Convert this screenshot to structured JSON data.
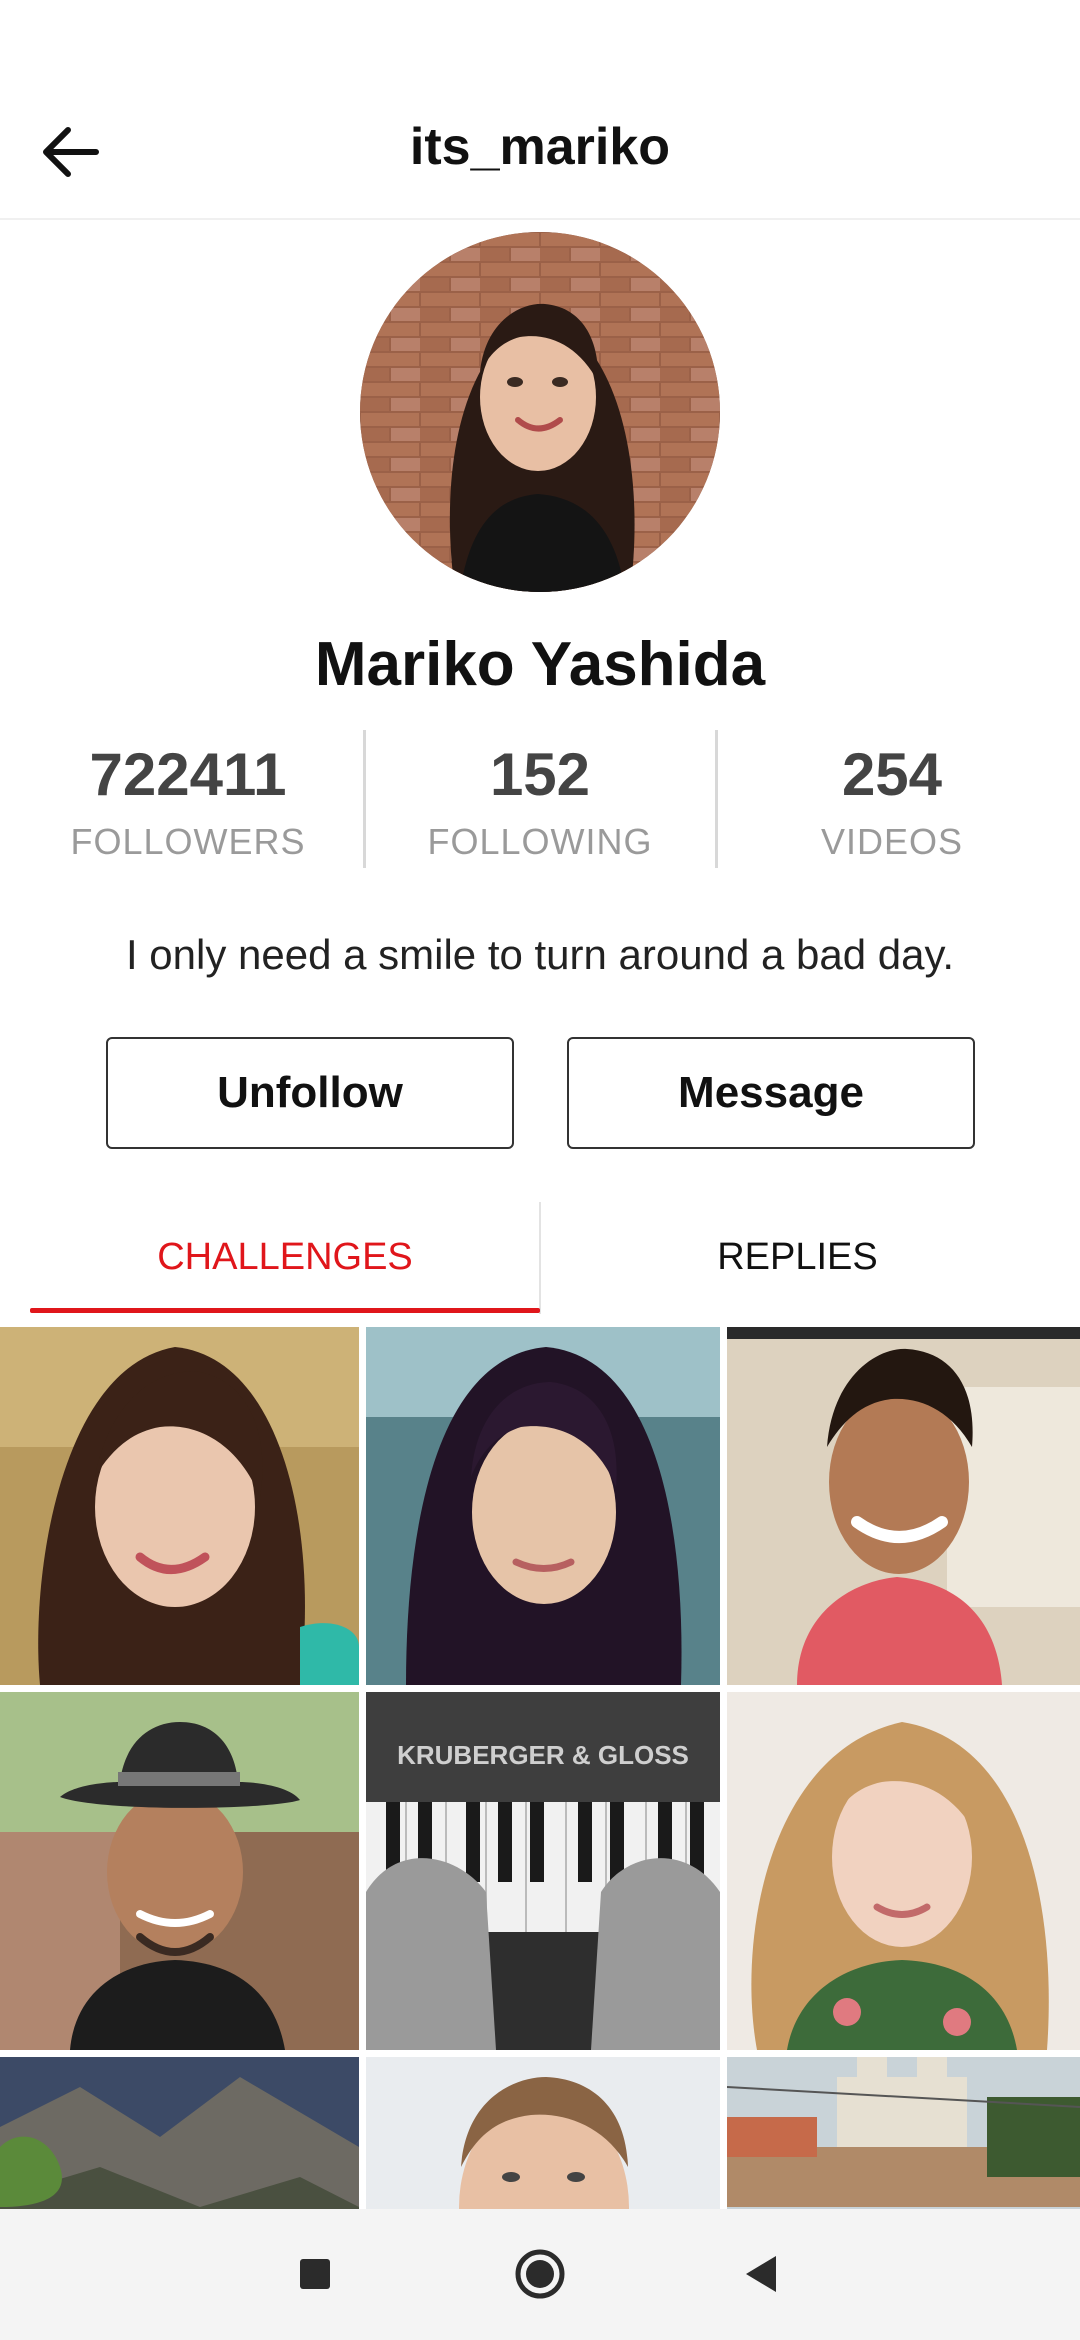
{
  "header": {
    "title": "its_mariko"
  },
  "profile": {
    "name": "Mariko Yashida",
    "bio": "I only need a smile to turn around a bad day."
  },
  "stats": [
    {
      "value": "722411",
      "label": "FOLLOWERS"
    },
    {
      "value": "152",
      "label": "FOLLOWING"
    },
    {
      "value": "254",
      "label": "VIDEOS"
    }
  ],
  "actions": {
    "unfollow_label": "Unfollow",
    "message_label": "Message"
  },
  "tabs": [
    {
      "label": "CHALLENGES",
      "active": true
    },
    {
      "label": "REPLIES",
      "active": false
    }
  ],
  "grid": {
    "piano_caption": "KRUBERGER & GLOSS",
    "items": [
      "video-thumbnail-woman-smiling",
      "video-thumbnail-woman-car",
      "video-thumbnail-man-smiling",
      "video-thumbnail-man-hat",
      "video-thumbnail-piano",
      "video-thumbnail-woman-blonde",
      "video-thumbnail-mountains",
      "video-thumbnail-man-portrait",
      "video-thumbnail-city"
    ]
  },
  "icons": {
    "back": "arrow-left-icon",
    "nav_recents": "square-icon",
    "nav_home": "circle-icon",
    "nav_back": "triangle-back-icon"
  },
  "colors": {
    "accent": "#e0161b",
    "stat_label": "#9a9a9a",
    "stat_value": "#444444"
  }
}
